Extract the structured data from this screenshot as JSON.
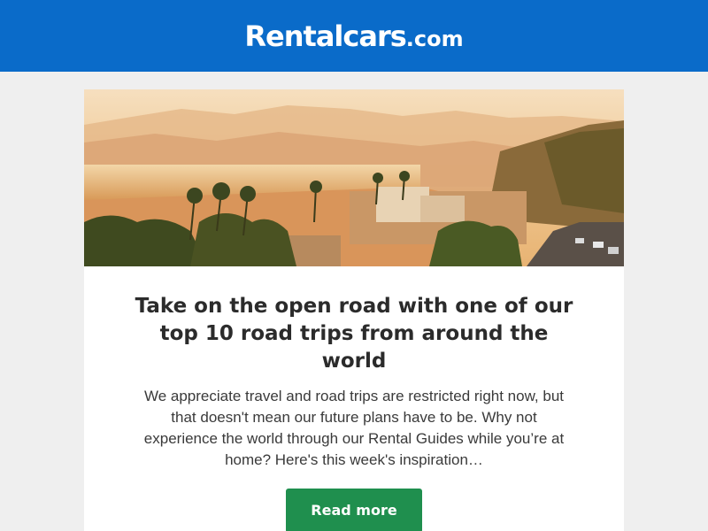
{
  "header": {
    "logo_main": "Rentalcars",
    "logo_suffix": ".com",
    "brand_color": "#0a6bc9"
  },
  "hero": {
    "icon": "coastal-road-sunset-image"
  },
  "article": {
    "headline": "Take on the open road with one of our top 10 road trips from around the world",
    "body": "We appreciate travel and road trips are restricted right now, but that doesn't mean our future plans have to be. Why not experience the world through our Rental Guides while you’re at home? Here's this week's inspiration…",
    "cta_label": "Read more",
    "cta_color": "#1f8f4e"
  }
}
